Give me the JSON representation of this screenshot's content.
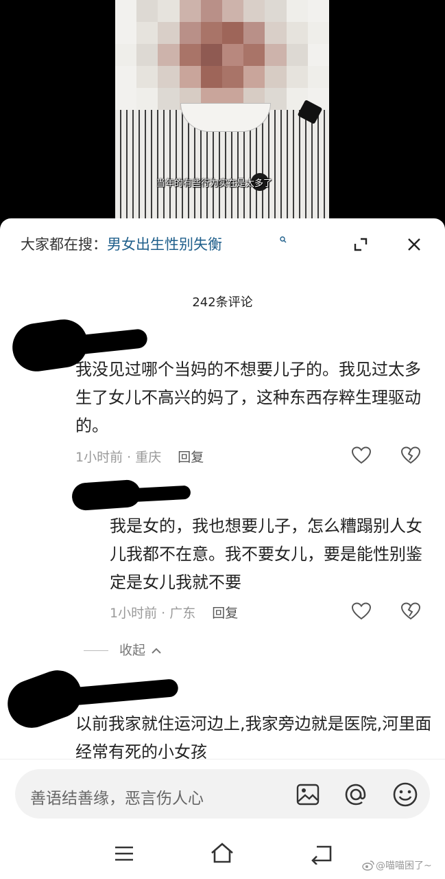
{
  "video": {
    "subtitle": "当年的有些行为实在是太多了"
  },
  "search": {
    "prefix": "大家都在搜：",
    "term": "男女出生性别失衡"
  },
  "comments_header": {
    "count": "242条评论"
  },
  "comments": [
    {
      "text": "我没见过哪个当妈的不想要儿子的。我见过太多生了女儿不高兴的妈了，这种东西存粹生理驱动的。",
      "time": "1小时前",
      "location": "重庆",
      "reply_label": "回复"
    },
    {
      "text": "我是女的，我也想要儿子，怎么糟蹋别人女儿我都不在意。我不要女儿，要是能性别鉴定是女儿我就不要",
      "time": "1小时前",
      "location": "广东",
      "reply_label": "回复"
    },
    {
      "text": "以前我家就住运河边上,我家旁边就是医院,河里面经常有死的小女孩"
    }
  ],
  "collapse_label": "收起",
  "input": {
    "placeholder": "善语结善缘，恶言伤人心"
  },
  "watermark": "@喵喵困了~",
  "icons": [
    "search-icon",
    "expand-icon",
    "close-icon",
    "like-icon",
    "dislike-icon",
    "chevron-up-icon",
    "image-icon",
    "at-icon",
    "emoji-icon",
    "menu-icon",
    "home-icon",
    "back-icon",
    "weibo-icon"
  ],
  "colors": {
    "search_term": "#1f5f8b",
    "sheet_background": "#ffffff",
    "meta_text": "#999999"
  }
}
